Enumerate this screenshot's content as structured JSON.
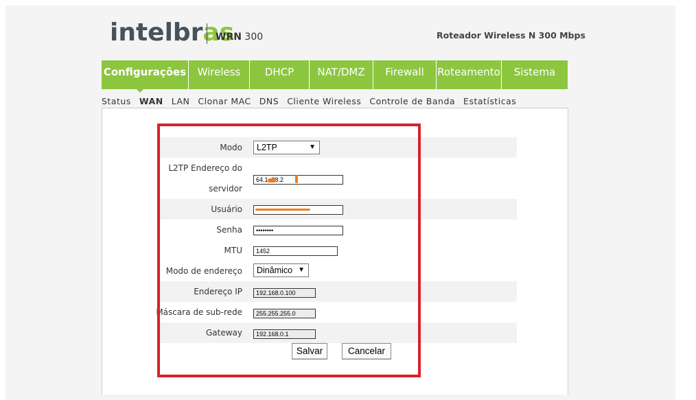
{
  "header": {
    "logo_main": "intelbr",
    "logo_accent": "as",
    "model_prefix": "WRN",
    "model_number": "300",
    "tagline": "Roteador Wireless N 300 Mbps"
  },
  "mainnav": {
    "items": [
      "Configurações",
      "Wireless",
      "DHCP",
      "NAT/DMZ",
      "Firewall",
      "Roteamento",
      "Sistema"
    ],
    "active": "Configurações"
  },
  "subnav": {
    "items": [
      "Status",
      "WAN",
      "LAN",
      "Clonar MAC",
      "DNS",
      "Cliente Wireless",
      "Controle de Banda",
      "Estatísticas"
    ],
    "active": "WAN"
  },
  "form": {
    "modo_label": "Modo",
    "modo_value": "L2TP",
    "servidor_label_1": "L2TP Endereço do",
    "servidor_label_2": "servidor",
    "servidor_value": "64.1  .28.2",
    "usuario_label": "Usuário",
    "usuario_value": "",
    "senha_label": "Senha",
    "senha_value": "••••••••",
    "mtu_label": "MTU",
    "mtu_value": "1452",
    "modo_endereco_label": "Modo de endereço",
    "modo_endereco_value": "Dinâmico",
    "ip_label": "Endereço IP",
    "ip_value": "192.168.0.100",
    "mascara_label": "Máscara de sub-rede",
    "mascara_value": "255.255.255.0",
    "gateway_label": "Gateway",
    "gateway_value": "192.168.0.1",
    "save_label": "Salvar",
    "cancel_label": "Cancelar"
  },
  "colors": {
    "brand_green": "#8cc63f",
    "highlight_red": "#d9222a",
    "redaction_orange": "#f07d1a"
  }
}
